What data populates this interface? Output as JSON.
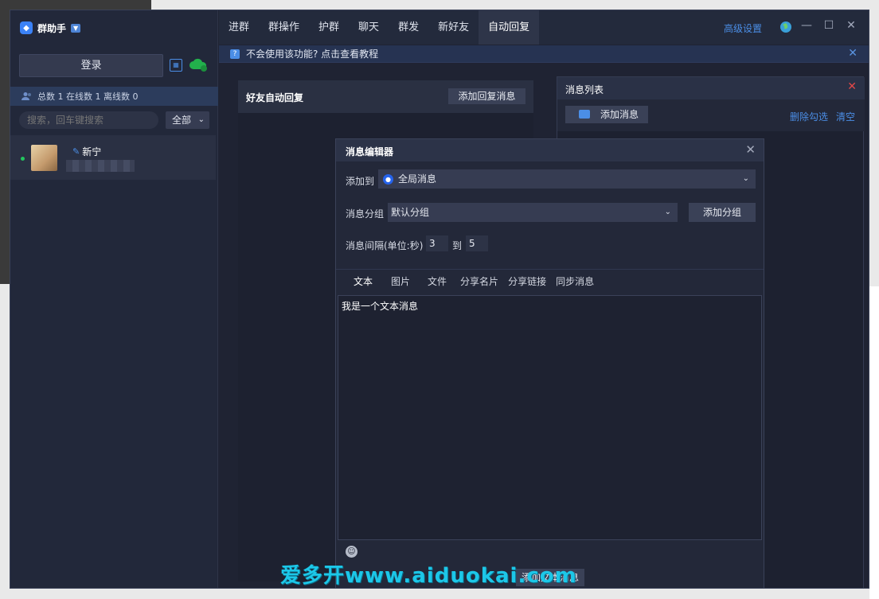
{
  "app": {
    "title": "群助手"
  },
  "sidebar": {
    "login_label": "登录",
    "stats": "总数 1 在线数 1 离线数 0",
    "search_placeholder": "搜索，回车键搜索",
    "filter_value": "全部",
    "contacts": [
      {
        "name": "新宁",
        "status": "online"
      }
    ]
  },
  "nav": {
    "tabs": [
      {
        "label": "进群"
      },
      {
        "label": "群操作"
      },
      {
        "label": "护群"
      },
      {
        "label": "聊天"
      },
      {
        "label": "群发"
      },
      {
        "label": "新好友"
      },
      {
        "label": "自动回复",
        "active": true
      }
    ],
    "advanced_settings": "高级设置"
  },
  "notice": {
    "text": "不会使用该功能? 点击查看教程"
  },
  "auto_reply": {
    "title": "好友自动回复",
    "add_button": "添加回复消息"
  },
  "message_list": {
    "title": "消息列表",
    "add_button": "添加消息",
    "delete_checked": "删除勾选",
    "clear": "清空"
  },
  "editor": {
    "title": "消息编辑器",
    "add_to_label": "添加到",
    "add_to_value": "全局消息",
    "group_label": "消息分组",
    "group_value": "默认分组",
    "add_group_button": "添加分组",
    "interval_label": "消息间隔(单位:秒)",
    "interval_from": "3",
    "interval_to_label": "到",
    "interval_to": "5",
    "tabs": [
      "文本",
      "图片",
      "文件",
      "分享名片",
      "分享链接",
      "同步消息"
    ],
    "active_tab": "文本",
    "text_value": "我是一个文本消息",
    "add_text_button": "添加文本消息"
  },
  "watermark": "爱多开www.aiduokai.com",
  "colors": {
    "accent": "#4b8ee6",
    "online": "#22c55e",
    "close_red": "#e24848"
  }
}
